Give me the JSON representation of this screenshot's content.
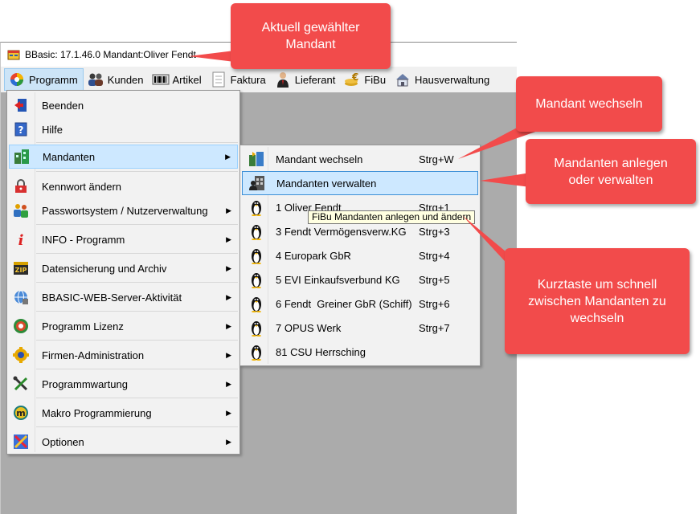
{
  "window": {
    "title": "BBasic: 17.1.46.0 Mandant:Oliver Fendt",
    "icon": "app-window-icon"
  },
  "menubar": {
    "items": [
      {
        "label": "Programm",
        "icon": "programm-icon"
      },
      {
        "label": "Kunden",
        "icon": "kunden-icon"
      },
      {
        "label": "Artikel",
        "icon": "artikel-icon"
      },
      {
        "label": "Faktura",
        "icon": "faktura-icon"
      },
      {
        "label": "Lieferant",
        "icon": "lieferant-icon"
      },
      {
        "label": "FiBu",
        "icon": "fibu-icon"
      },
      {
        "label": "Hausverwaltung",
        "icon": "hausverwaltung-icon"
      }
    ]
  },
  "programm_menu": {
    "items": [
      {
        "label": "Beenden",
        "icon": "exit-icon"
      },
      {
        "label": "Hilfe",
        "icon": "help-icon"
      },
      {
        "label": "Mandanten",
        "icon": "mandanten-icon"
      },
      {
        "label": "Kennwort ändern",
        "icon": "lock-icon"
      },
      {
        "label": "Passwortsystem / Nutzerverwaltung",
        "icon": "users-icon"
      },
      {
        "label": "INFO - Programm",
        "icon": "info-icon"
      },
      {
        "label": "Datensicherung und Archiv",
        "icon": "zip-icon"
      },
      {
        "label": "BBASIC-WEB-Server-Aktivität",
        "icon": "server-icon"
      },
      {
        "label": "Programm Lizenz",
        "icon": "license-icon"
      },
      {
        "label": "Firmen-Administration",
        "icon": "company-icon"
      },
      {
        "label": "Programmwartung",
        "icon": "tools-icon"
      },
      {
        "label": "Makro Programmierung",
        "icon": "macro-icon"
      },
      {
        "label": "Optionen",
        "icon": "options-icon"
      }
    ]
  },
  "mandanten_submenu": {
    "items": [
      {
        "label": "Mandant wechseln",
        "shortcut": "Strg+W",
        "icon": "switch-mandant-icon"
      },
      {
        "label": "Mandanten verwalten",
        "shortcut": "",
        "icon": "manage-mandanten-icon"
      },
      {
        "label": "1 Oliver Fendt",
        "shortcut": "Strg+1",
        "icon": "penguin-icon"
      },
      {
        "label": "3 Fendt Vermögensverw.KG",
        "shortcut": "Strg+3",
        "icon": "penguin-icon"
      },
      {
        "label": "4 Europark GbR",
        "shortcut": "Strg+4",
        "icon": "penguin-icon"
      },
      {
        "label": "5 EVI Einkaufsverbund KG",
        "shortcut": "Strg+5",
        "icon": "penguin-icon"
      },
      {
        "label": "6 Fendt  Greiner GbR (Schiff)",
        "shortcut": "Strg+6",
        "icon": "penguin-icon"
      },
      {
        "label": "7 OPUS Werk",
        "shortcut": "Strg+7",
        "icon": "penguin-icon"
      },
      {
        "label": "81 CSU Herrsching",
        "shortcut": "",
        "icon": "penguin-icon"
      }
    ]
  },
  "tooltip": "FiBu Mandanten anlegen und ändern",
  "callouts": {
    "current_mandant": [
      "Aktuell gewählter",
      "Mandant"
    ],
    "switch": [
      "Mandant wechseln"
    ],
    "manage": [
      "Mandanten anlegen",
      "oder verwalten"
    ],
    "shortcut": [
      "Kurztaste um schnell",
      "zwischen Mandanten zu",
      "wechseln"
    ]
  },
  "colors": {
    "callout": "#f24b4b",
    "selection": "#cde8ff",
    "workspace": "#ababab"
  }
}
